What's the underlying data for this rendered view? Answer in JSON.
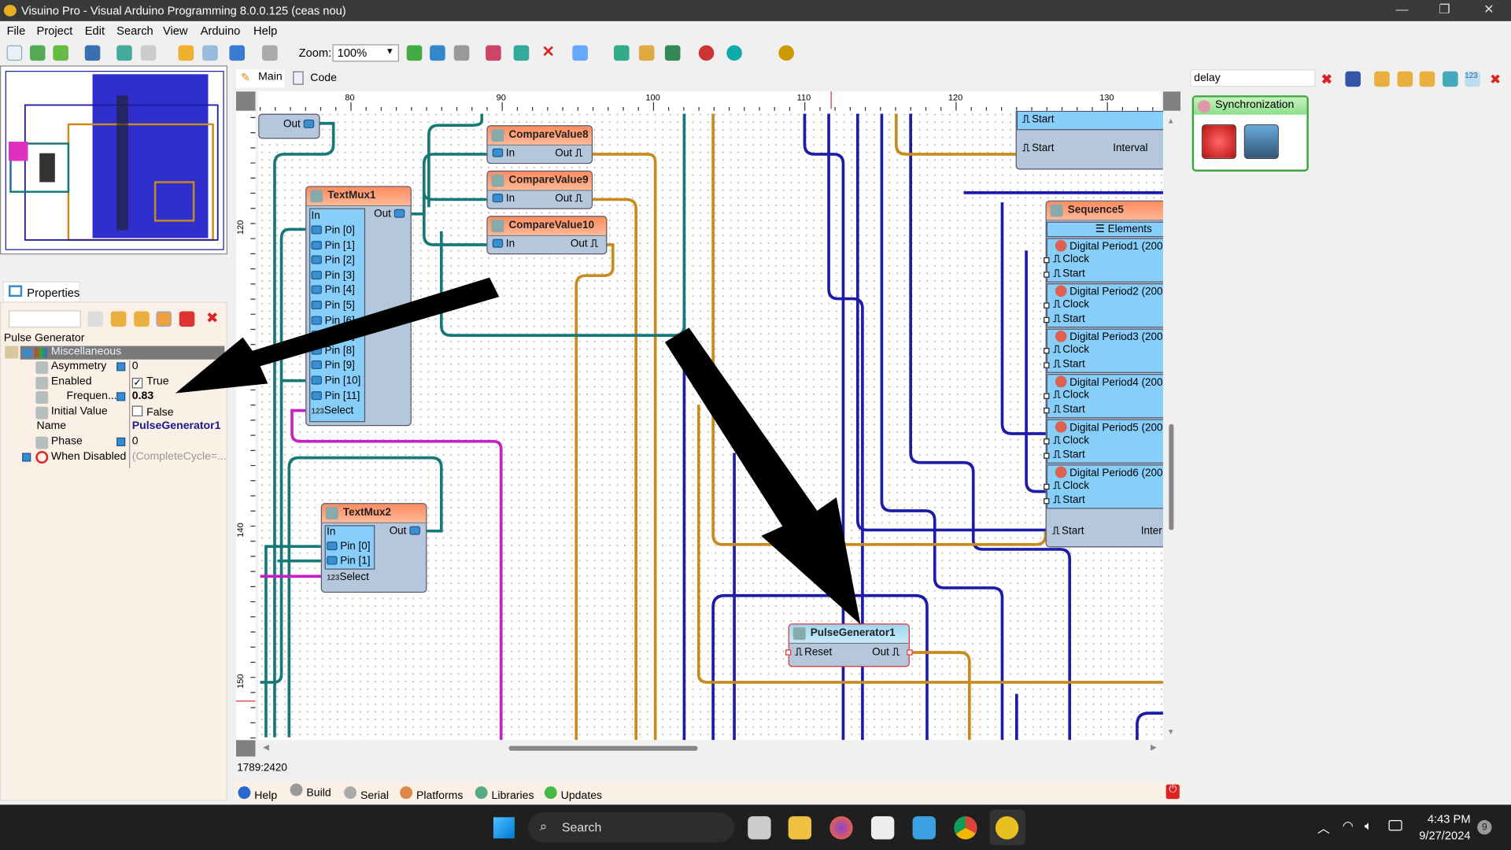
{
  "window": {
    "title": "Visuino Pro - Visual Arduino Programming 8.0.0.125 (ceas nou)",
    "minimize": "—",
    "maximize": "❐",
    "close": "✕"
  },
  "menu": [
    "File",
    "Project",
    "Edit",
    "Search",
    "View",
    "Arduino",
    "Help"
  ],
  "toolbar": {
    "zoom_label": "Zoom:",
    "zoom_value": "100%"
  },
  "tabs": {
    "main": "Main",
    "code": "Code"
  },
  "ruler": {
    "top": [
      "80",
      "90",
      "100",
      "110",
      "120",
      "130"
    ],
    "left": [
      "120",
      "130",
      "140",
      "150"
    ]
  },
  "properties": {
    "tab": "Properties",
    "search_value": "",
    "component": "Pulse Generator",
    "category": "Miscellaneous",
    "rows": [
      {
        "name": "Asymmetry",
        "value": "0"
      },
      {
        "name": "Enabled",
        "value": "True",
        "checked": true
      },
      {
        "name": "Frequen...",
        "value": "0.83"
      },
      {
        "name": "Initial Value",
        "value": "False",
        "checked": false
      },
      {
        "name": "Name",
        "value": "PulseGenerator1"
      },
      {
        "name": "Phase",
        "value": "0"
      },
      {
        "name": "When Disabled",
        "value": "(CompleteCycle=..."
      }
    ]
  },
  "canvas": {
    "partial_out": "Out",
    "textmux1": {
      "title": "TextMux1",
      "in": "In",
      "out": "Out",
      "pins": [
        "Pin [0]",
        "Pin [1]",
        "Pin [2]",
        "Pin [3]",
        "Pin [4]",
        "Pin [5]",
        "Pin [6]",
        "Pin [7]",
        "Pin [8]",
        "Pin [9]",
        "Pin [10]",
        "Pin [11]"
      ],
      "select": "Select"
    },
    "textmux2": {
      "title": "TextMux2",
      "in": "In",
      "out": "Out",
      "pins": [
        "Pin [0]",
        "Pin [1]"
      ],
      "select": "Select"
    },
    "compare": [
      {
        "title": "CompareValue8",
        "in": "In",
        "out": "Out"
      },
      {
        "title": "CompareValue9",
        "in": "In",
        "out": "Out"
      },
      {
        "title": "CompareValue10",
        "in": "In",
        "out": "Out"
      }
    ],
    "topright": {
      "start1": "Start",
      "start2": "Start",
      "interval": "Interval"
    },
    "sequence5": {
      "title": "Sequence5",
      "elements": "Elements",
      "items": [
        "Digital Period1 (200",
        "Digital Period2 (200",
        "Digital Period3 (200",
        "Digital Period4 (200",
        "Digital Period5 (200",
        "Digital Period6 (200"
      ],
      "clock": "Clock",
      "start": "Start",
      "bottom_start": "Start",
      "bottom_interval": "Inter"
    },
    "pulsegen": {
      "title": "PulseGenerator1",
      "reset": "Reset",
      "out": "Out"
    }
  },
  "status": {
    "coords": "1789:2420"
  },
  "bottom_tabs": [
    "Help",
    "Build",
    "Serial",
    "Platforms",
    "Libraries",
    "Updates"
  ],
  "right_panel": {
    "search_value": "delay",
    "palette_title": "Synchronization"
  },
  "taskbar": {
    "search": "Search",
    "time": "4:43 PM",
    "date": "9/27/2024",
    "badge": "9"
  },
  "colors": {
    "wire_teal": "#177878",
    "wire_orange": "#c98a1e",
    "wire_blue": "#1c1ca8",
    "wire_magenta": "#c820c8",
    "component_header": "#ff9a70",
    "component_body": "#b5c7dd"
  }
}
